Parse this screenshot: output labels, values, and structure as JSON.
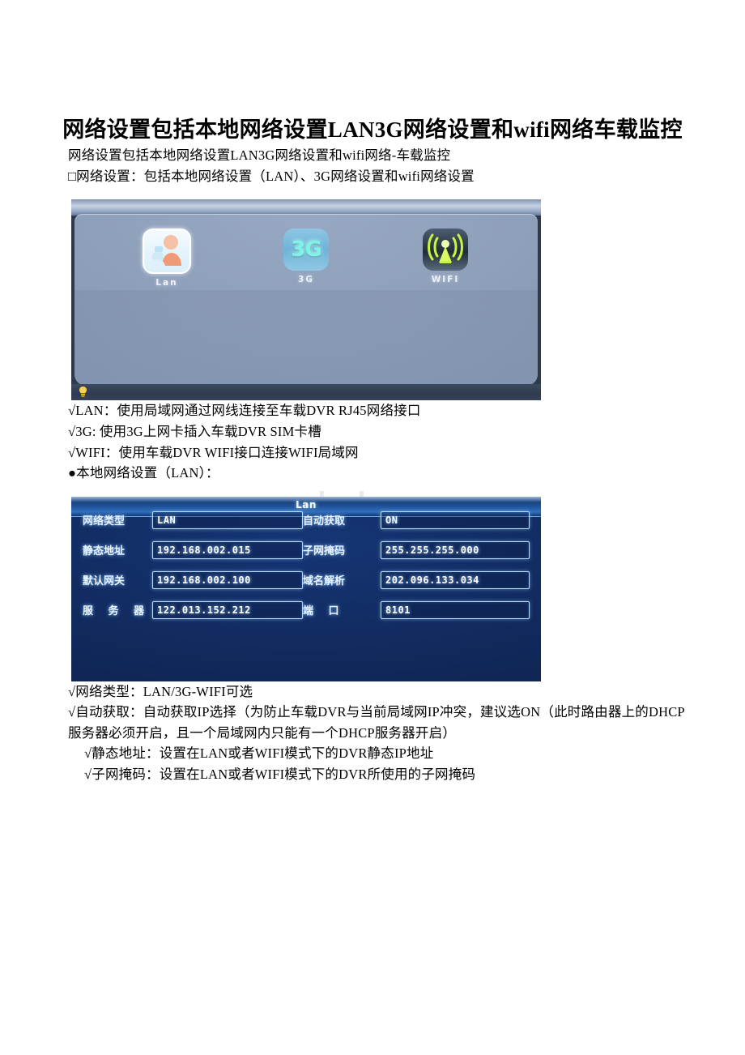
{
  "document": {
    "title": "网络设置包括本地网络设置LAN3G网络设置和wifi网络车载监控",
    "watermark": "www.bdocx.com",
    "paragraphs": {
      "intro": "网络设置包括本地网络设置LAN3G网络设置和wifi网络-车载监控",
      "overview": "□网络设置：包括本地网络设置（LAN）、3G网络设置和wifi网络设置",
      "lan_desc": "√LAN：使用局域网通过网线连接至车载DVR RJ45网络接口",
      "g3_desc": "√3G: 使用3G上网卡插入车载DVR SIM卡槽",
      "wifi_desc": "√WIFI：使用车载DVR WIFI接口连接WIFI局域网",
      "section_lan": "●本地网络设置（LAN）：",
      "net_type_desc": "√网络类型：LAN/3G-WIFI可选",
      "dhcp_desc": "√自动获取：自动获取IP选择（为防止车载DVR与当前局域网IP冲突，建议选ON（此时路由器上的DHCP服务器必须开启，且一个局域网内只能有一个DHCP服务器开启）",
      "static_ip_desc": "√静态地址：设置在LAN或者WIFI模式下的DVR静态IP地址",
      "subnet_desc": "√子网掩码：设置在LAN或者WIFI模式下的DVR所使用的子网掩码"
    }
  },
  "menu_screenshot": {
    "icons": [
      {
        "label": "Lan",
        "icon": "lan-person-icon",
        "selected": true
      },
      {
        "label": "3G",
        "icon": "3g-icon",
        "glyph": "3G",
        "selected": false
      },
      {
        "label": "WIFI",
        "icon": "wifi-antenna-icon",
        "selected": false
      }
    ],
    "status_icon": "bulb-icon"
  },
  "lan_settings_screenshot": {
    "title": "Lan",
    "rows": [
      {
        "left": {
          "label": "网络类型",
          "value": "LAN",
          "spaced": false
        },
        "right": {
          "label": "自动获取",
          "value": "ON",
          "spaced": false
        }
      },
      {
        "left": {
          "label": "静态地址",
          "value": "192.168.002.015",
          "spaced": false
        },
        "right": {
          "label": "子网掩码",
          "value": "255.255.255.000",
          "spaced": false
        }
      },
      {
        "left": {
          "label": "默认网关",
          "value": "192.168.002.100",
          "spaced": false
        },
        "right": {
          "label": "域名解析",
          "value": "202.096.133.034",
          "spaced": false
        }
      },
      {
        "left": {
          "label": "服 务 器",
          "value": "122.013.152.212",
          "spaced": true
        },
        "right": {
          "label": "端    口",
          "value": "8101",
          "spaced": true
        }
      }
    ]
  },
  "colors": {
    "field_border": "#bcdcff",
    "panel_bg": "#112a5d",
    "title_bar": "#2f6fbe",
    "wifi_green": "#c8f542",
    "g3_cyan": "#7ff3e6"
  }
}
